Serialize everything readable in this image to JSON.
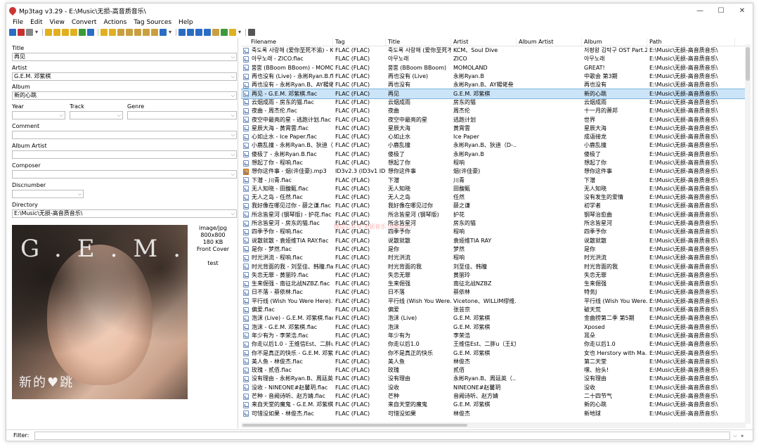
{
  "window": {
    "title": "Mp3tag v3.29 - E:\\Music\\无损-高音质音乐\\",
    "controls": {
      "minimize": "—",
      "maximize": "☐",
      "close": "✕"
    }
  },
  "menu": [
    "File",
    "Edit",
    "View",
    "Convert",
    "Actions",
    "Tag Sources",
    "Help"
  ],
  "toolbar": {
    "icons": [
      "save-icon",
      "remove-tag-icon",
      "undo-icon",
      "dropdown-arrow-icon",
      "change-directory-icon",
      "add-directory-icon",
      "open-folder-icon",
      "favorite-icon",
      "refresh-icon",
      "select-icon",
      "cut-icon",
      "paste-icon",
      "tag-to-filename-icon",
      "filename-to-tag-icon",
      "filename-to-filename-icon",
      "text-to-tag-icon",
      "tag-to-text-icon",
      "case-conversion-icon",
      "dropdown-arrow-icon",
      "export-icon",
      "playlist-icon",
      "tag-sources-icon",
      "tools-icon",
      "lyrics-icon",
      "globe-icon",
      "web-sources-icon",
      "dropdown-arrow-icon",
      "options-icon"
    ],
    "colors": {
      "accent_blue": "#2b6cc4",
      "accent_yellow": "#e0b020",
      "accent_red": "#c83030",
      "accent_green": "#3a9a3a"
    }
  },
  "tag_panel": {
    "title_label": "Title",
    "title_value": "再见",
    "artist_label": "Artist",
    "artist_value": "G.E.M. 邓紫棋",
    "album_label": "Album",
    "album_value": "新的心跳",
    "year_label": "Year",
    "year_value": "",
    "track_label": "Track",
    "track_value": "",
    "genre_label": "Genre",
    "genre_value": "",
    "comment_label": "Comment",
    "comment_value": "",
    "album_artist_label": "Album Artist",
    "album_artist_value": "",
    "composer_label": "Composer",
    "composer_value": "",
    "discnumber_label": "Discnumber",
    "discnumber_value": "",
    "directory_label": "Directory",
    "directory_value": "E:\\Music\\无损-高音质音乐\\"
  },
  "cover": {
    "mime": "image/jpg",
    "dimensions": "800x800",
    "size": "180 KB",
    "type": "Front Cover",
    "comment": "test",
    "art_title": "G.E.M.",
    "art_subtitle": "新的♥跳"
  },
  "columns": [
    "Filename",
    "Tag",
    "Title",
    "Artist",
    "Album Artist",
    "Album",
    "Path"
  ],
  "files": [
    {
      "filename": "죽도록 사랑해 (爱你至死不渝) - KCM...",
      "tag": "FLAC (FLAC)",
      "title": "죽도록 사랑해 (爱你至死不...",
      "artist": "KCM、Soul Dive",
      "album_artist": "",
      "album": "저평왕 김탁구 OST Part.2",
      "path": "E:\\Music\\无损-高音质音乐\\",
      "type": "flac"
    },
    {
      "filename": "아무노래 - ZICO.flac",
      "tag": "FLAC (FLAC)",
      "title": "아무노래",
      "artist": "ZICO",
      "album_artist": "",
      "album": "아무노래",
      "path": "E:\\Music\\无损-高音质音乐\\",
      "type": "flac"
    },
    {
      "filename": "뿜뿜 (BBoom BBoom) - MOMOLA...",
      "tag": "FLAC (FLAC)",
      "title": "뿜뿜 (BBoom BBoom)",
      "artist": "MOMOLAND",
      "album_artist": "",
      "album": "GREAT!",
      "path": "E:\\Music\\无损-高音质音乐\\",
      "type": "flac"
    },
    {
      "filename": "再也没有 (Live) - 永彬Ryan.B.flac",
      "tag": "FLAC (FLAC)",
      "title": "再也没有 (Live)",
      "artist": "永彬Ryan.B",
      "album_artist": "",
      "album": "中歌会 第3期",
      "path": "E:\\Music\\无损-高音质音乐\\",
      "type": "flac"
    },
    {
      "filename": "再也没有 - 永彬Ryan.B、AY楊佬叁.f...",
      "tag": "FLAC (FLAC)",
      "title": "再也没有",
      "artist": "永彬Ryan.B、AY楊佬叁",
      "album_artist": "",
      "album": "再也没有",
      "path": "E:\\Music\\无损-高音质音乐\\",
      "type": "flac"
    },
    {
      "filename": "再见 - G.E.M. 邓紫棋.flac",
      "tag": "FLAC (FLAC)",
      "title": "再见",
      "artist": "G.E.M. 邓紫棋",
      "album_artist": "",
      "album": "新的心跳",
      "path": "E:\\Music\\无损-高音质音乐\\",
      "type": "flac",
      "selected": true
    },
    {
      "filename": "云烟成雨 - 房东的猫.flac",
      "tag": "FLAC (FLAC)",
      "title": "云烟成雨",
      "artist": "房东的猫",
      "album_artist": "",
      "album": "云烟成雨",
      "path": "E:\\Music\\无损-高音质音乐\\",
      "type": "flac"
    },
    {
      "filename": "夜曲 - 周杰伦.flac",
      "tag": "FLAC (FLAC)",
      "title": "夜曲",
      "artist": "周杰伦",
      "album_artist": "",
      "album": "十一月的萧邦",
      "path": "E:\\Music\\无损-高音质音乐\\",
      "type": "flac"
    },
    {
      "filename": "夜空中最亮的星 - 逃跑计划.flac",
      "tag": "FLAC (FLAC)",
      "title": "夜空中最亮的星",
      "artist": "逃跑计划",
      "album_artist": "",
      "album": "世界",
      "path": "E:\\Music\\无损-高音质音乐\\",
      "type": "flac"
    },
    {
      "filename": "星辰大海 - 黄霄雲.flac",
      "tag": "FLAC (FLAC)",
      "title": "星辰大海",
      "artist": "黄霄雲",
      "album_artist": "",
      "album": "星辰大海",
      "path": "E:\\Music\\无损-高音质音乐\\",
      "type": "flac"
    },
    {
      "filename": "心如止水 - Ice Paper.flac",
      "tag": "FLAC (FLAC)",
      "title": "心如止水",
      "artist": "Ice Paper",
      "album_artist": "",
      "album": "成语接龙",
      "path": "E:\\Music\\无损-高音质音乐\\",
      "type": "flac"
    },
    {
      "filename": "小鹿乱撞 - 永彬Ryan.B、狄迪（D-D...",
      "tag": "FLAC (FLAC)",
      "title": "小鹿乱撞",
      "artist": "永彬Ryan.B、狄迪（D-...",
      "album_artist": "",
      "album": "小鹿乱撞",
      "path": "E:\\Music\\无损-高音质音乐\\",
      "type": "flac"
    },
    {
      "filename": "傻极了 - 永彬Ryan.B.flac",
      "tag": "FLAC (FLAC)",
      "title": "傻极了",
      "artist": "永彬Ryan.B",
      "album_artist": "",
      "album": "傻极了",
      "path": "E:\\Music\\无损-高音质音乐\\",
      "type": "flac"
    },
    {
      "filename": "想起了你 - 程响.flac",
      "tag": "FLAC (FLAC)",
      "title": "想起了你",
      "artist": "程响",
      "album_artist": "",
      "album": "想起了你",
      "path": "E:\\Music\\无损-高音质音乐\\",
      "type": "flac"
    },
    {
      "filename": "想你这件事 - 烟(许佳豪).mp3",
      "tag": "ID3v2.3 (ID3v1 ID...",
      "title": "想你这件事",
      "artist": "烟(许佳豪)",
      "album_artist": "",
      "album": "想你这件事",
      "path": "E:\\Music\\无损-高音质音乐\\",
      "type": "mp3"
    },
    {
      "filename": "下潜 - 川青.flac",
      "tag": "FLAC (FLAC)",
      "title": "下潜",
      "artist": "川青",
      "album_artist": "",
      "album": "下潜",
      "path": "E:\\Music\\无损-高音质音乐\\",
      "type": "flac"
    },
    {
      "filename": "无人知晓 - 田馥甄.flac",
      "tag": "FLAC (FLAC)",
      "title": "无人知晓",
      "artist": "田馥甄",
      "album_artist": "",
      "album": "无人知晓",
      "path": "E:\\Music\\无损-高音质音乐\\",
      "type": "flac"
    },
    {
      "filename": "无人之岛 - 任然.flac",
      "tag": "FLAC (FLAC)",
      "title": "无人之岛",
      "artist": "任然",
      "album_artist": "",
      "album": "没有发生的爱情",
      "path": "E:\\Music\\无损-高音质音乐\\",
      "type": "flac"
    },
    {
      "filename": "我好像在哪见过你 - 薛之谦.flac",
      "tag": "FLAC (FLAC)",
      "title": "我好像在哪见过你",
      "artist": "薛之谦",
      "album_artist": "",
      "album": "初学者",
      "path": "E:\\Music\\无损-高音质音乐\\",
      "type": "flac"
    },
    {
      "filename": "所念皆星河 (钢琴版) - 护花.flac",
      "tag": "FLAC (FLAC)",
      "title": "所念皆星河 (钢琴版)",
      "artist": "护花",
      "album_artist": "",
      "album": "钢琴治愈曲",
      "path": "E:\\Music\\无损-高音质音乐\\",
      "type": "flac"
    },
    {
      "filename": "所念皆星河 - 房东的猫.flac",
      "tag": "FLAC (FLAC)",
      "title": "所念皆星河",
      "artist": "房东的猫",
      "album_artist": "",
      "album": "所念皆星河",
      "path": "E:\\Music\\无损-高音质音乐\\",
      "type": "flac"
    },
    {
      "filename": "四季予你 - 程响.flac",
      "tag": "FLAC (FLAC)",
      "title": "四季予你",
      "artist": "程响",
      "album_artist": "",
      "album": "四季予你",
      "path": "E:\\Music\\无损-高音质音乐\\",
      "type": "flac"
    },
    {
      "filename": "说散就散 - 袁娅维TIA RAY.flac",
      "tag": "FLAC (FLAC)",
      "title": "说散就散",
      "artist": "袁娅维TIA RAY",
      "album_artist": "",
      "album": "说散就散",
      "path": "E:\\Music\\无损-高音质音乐\\",
      "type": "flac"
    },
    {
      "filename": "是你 - 梦然.flac",
      "tag": "FLAC (FLAC)",
      "title": "是你",
      "artist": "梦然",
      "album_artist": "",
      "album": "是你",
      "path": "E:\\Music\\无损-高音质音乐\\",
      "type": "flac"
    },
    {
      "filename": "时光洪流 - 程响.flac",
      "tag": "FLAC (FLAC)",
      "title": "时光洪流",
      "artist": "程响",
      "album_artist": "",
      "album": "时光洪流",
      "path": "E:\\Music\\无损-高音质音乐\\",
      "type": "flac"
    },
    {
      "filename": "时光背面的我 - 刘至佳、韩瞳.flac",
      "tag": "FLAC (FLAC)",
      "title": "时光背面的我",
      "artist": "刘至佳、韩瞳",
      "album_artist": "",
      "album": "时光背面的我",
      "path": "E:\\Music\\无损-高音质音乐\\",
      "type": "flac"
    },
    {
      "filename": "失恋无罪 - 黄丽玲.flac",
      "tag": "FLAC (FLAC)",
      "title": "失恋无罪",
      "artist": "黄丽玲",
      "album_artist": "",
      "album": "失恋无罪",
      "path": "E:\\Music\\无损-高音质音乐\\",
      "type": "flac"
    },
    {
      "filename": "生来倔强 - 南征北战NZBZ.flac",
      "tag": "FLAC (FLAC)",
      "title": "生来倔强",
      "artist": "南征北战NZBZ",
      "album_artist": "",
      "album": "生来倔强",
      "path": "E:\\Music\\无损-高音质音乐\\",
      "type": "flac"
    },
    {
      "filename": "日不落 - 蔡依林.flac",
      "tag": "FLAC (FLAC)",
      "title": "日不落",
      "artist": "蔡依林",
      "album_artist": "",
      "album": "特务J",
      "path": "E:\\Music\\无损-高音质音乐\\",
      "type": "flac"
    },
    {
      "filename": "平行线 (Wish You Were Here).flac",
      "tag": "FLAC (FLAC)",
      "title": "平行线 (Wish You Were...",
      "artist": "Vicetone、WILLIM缪维...",
      "album_artist": "",
      "album": "平行线 (Wish You Were...",
      "path": "E:\\Music\\无损-高音质音乐\\",
      "type": "flac"
    },
    {
      "filename": "偏爱.flac",
      "tag": "FLAC (FLAC)",
      "title": "偏爱",
      "artist": "张芸京",
      "album_artist": "",
      "album": "破天荒",
      "path": "E:\\Music\\无损-高音质音乐\\",
      "type": "flac"
    },
    {
      "filename": "泡沫 (Live) - G.E.M. 邓紫棋.flac",
      "tag": "FLAC (FLAC)",
      "title": "泡沫 (Live)",
      "artist": "G.E.M. 邓紫棋",
      "album_artist": "",
      "album": "金曲捞第二季 第5期",
      "path": "E:\\Music\\无损-高音质音乐\\",
      "type": "flac"
    },
    {
      "filename": "泡沫 - G.E.M. 邓紫棋.flac",
      "tag": "FLAC (FLAC)",
      "title": "泡沫",
      "artist": "G.E.M. 邓紫棋",
      "album_artist": "",
      "album": "Xposed",
      "path": "E:\\Music\\无损-高音质音乐\\",
      "type": "flac"
    },
    {
      "filename": "年少有为 - 李荣浩.flac",
      "tag": "FLAC (FLAC)",
      "title": "年少有为",
      "artist": "李荣浩",
      "album_artist": "",
      "album": "耳朵",
      "path": "E:\\Music\\无损-高音质音乐\\",
      "type": "flac"
    },
    {
      "filename": "你走以后1.0 - 王维信Est、二胖u（...",
      "tag": "FLAC (FLAC)",
      "title": "你走以后1.0",
      "artist": "王维信Est、二胖u（王幻...",
      "album_artist": "",
      "album": "你走以后1.0",
      "path": "E:\\Music\\无损-高音质音乐\\",
      "type": "flac"
    },
    {
      "filename": "你不是真正的快乐 - G.E.M. 邓紫棋.fl...",
      "tag": "FLAC (FLAC)",
      "title": "你不是真正的快乐",
      "artist": "G.E.M. 邓紫棋",
      "album_artist": "",
      "album": "女也 Herstory with Ma...",
      "path": "E:\\Music\\无损-高音质音乐\\",
      "type": "flac"
    },
    {
      "filename": "美人鱼 - 林俊杰.flac",
      "tag": "FLAC (FLAC)",
      "title": "美人鱼",
      "artist": "林俊杰",
      "album_artist": "",
      "album": "第二天堂",
      "path": "E:\\Music\\无损-高音质音乐\\",
      "type": "flac"
    },
    {
      "filename": "玫瑰 - 贰佰.flac",
      "tag": "FLAC (FLAC)",
      "title": "玫瑰",
      "artist": "贰佰",
      "album_artist": "",
      "album": "嘿、抬头!",
      "path": "E:\\Music\\无损-高音质音乐\\",
      "type": "flac"
    },
    {
      "filename": "没有理由 - 永彬Ryan.B、周廷英（苏...",
      "tag": "FLAC (FLAC)",
      "title": "没有理由",
      "artist": "永彬Ryan.B、周廷英（...",
      "album_artist": "",
      "album": "没有理由",
      "path": "E:\\Music\\无损-高音质音乐\\",
      "type": "flac"
    },
    {
      "filename": "没收 - NINEONE#赵馨玥.flac",
      "tag": "FLAC (FLAC)",
      "title": "没收",
      "artist": "NINEONE#赵馨玥",
      "album_artist": "",
      "album": "没收",
      "path": "E:\\Music\\无损-高音质音乐\\",
      "type": "flac"
    },
    {
      "filename": "芒种 - 音阙诗听、赵方婧.flac",
      "tag": "FLAC (FLAC)",
      "title": "芒种",
      "artist": "音阙诗听、赵方婧",
      "album_artist": "",
      "album": "二十四节气",
      "path": "E:\\Music\\无损-高音质音乐\\",
      "type": "flac"
    },
    {
      "filename": "来自天堂的魔鬼 - G.E.M. 邓紫棋.flac",
      "tag": "FLAC (FLAC)",
      "title": "来自天堂的魔鬼",
      "artist": "G.E.M. 邓紫棋",
      "album_artist": "",
      "album": "新的心跳",
      "path": "E:\\Music\\无损-高音质音乐\\",
      "type": "flac"
    },
    {
      "filename": "可惜没如果 - 林俊杰.flac",
      "tag": "FLAC (FLAC)",
      "title": "可惜没如果",
      "artist": "林俊杰",
      "album_artist": "",
      "album": "新地球",
      "path": "E:\\Music\\无损-高音质音乐\\",
      "type": "flac"
    }
  ],
  "watermark": "微信公众号 无损音乐 (BBoom)",
  "filter": {
    "label": "Filter:",
    "value": ""
  }
}
